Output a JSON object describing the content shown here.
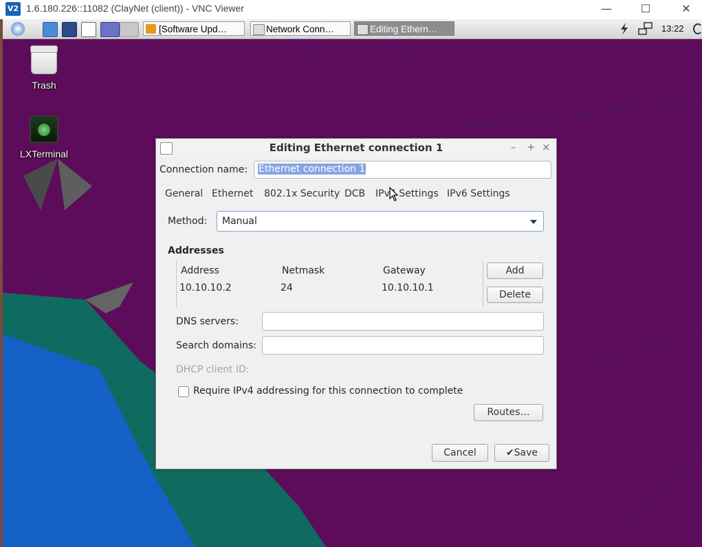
{
  "vnc": {
    "logo": "V2",
    "title": "1.6.180.226::11082 (ClayNet (client)) - VNC Viewer",
    "minimize": "—",
    "maximize": "☐",
    "close": "✕"
  },
  "panel": {
    "tasks": [
      {
        "label": "[Software Upd…",
        "active": false
      },
      {
        "label": "Network Conn…",
        "active": false
      },
      {
        "label": "Editing Ethern…",
        "active": true
      }
    ],
    "clock": "13:22"
  },
  "desktop": {
    "icons": [
      {
        "label": "Trash",
        "icon": "trash-icon"
      },
      {
        "label": "LXTerminal",
        "icon": "terminal-icon"
      }
    ]
  },
  "dialog": {
    "title": "Editing Ethernet connection 1",
    "controls": {
      "minimize": "–",
      "maximize": "+",
      "close": "×"
    },
    "connection_name_label": "Connection name:",
    "connection_name_value": "Ethernet connection 1",
    "tabs": [
      "General",
      "Ethernet",
      "802.1x Security",
      "DCB",
      "IPv4 Settings",
      "IPv6 Settings"
    ],
    "method_label": "Method:",
    "method_value": "Manual",
    "addresses_heading": "Addresses",
    "addresses": {
      "columns": [
        "Address",
        "Netmask",
        "Gateway"
      ],
      "rows": [
        [
          "10.10.10.2",
          "24",
          "10.10.10.1"
        ]
      ]
    },
    "add_button": "Add",
    "delete_button": "Delete",
    "dns_label": "DNS servers:",
    "dns_value": "",
    "search_domains_label": "Search domains:",
    "search_domains_value": "",
    "dhcp_label": "DHCP client ID:",
    "require_ipv4_label": "Require IPv4 addressing for this connection to complete",
    "routes_button": "Routes…",
    "cancel_button": "Cancel",
    "save_button": "Save"
  }
}
